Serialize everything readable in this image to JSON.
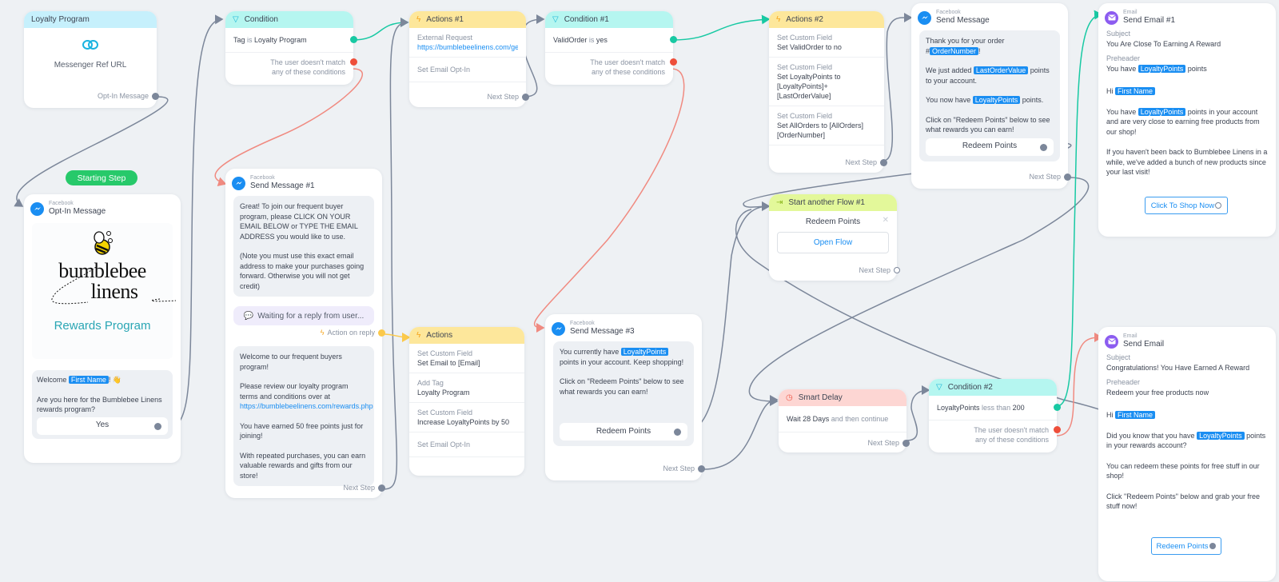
{
  "colors": {
    "canvas": "#eef1f4",
    "condition_header": "#b5f6f0",
    "actions_header": "#fde79b",
    "trigger_header": "#c6f0fc",
    "flow_header": "#e3f89a",
    "delay_header": "#fdd6d3",
    "start_badge": "#27c96a",
    "variable_tag": "#1a8ef2",
    "link": "#1a8ef2",
    "wire": "#7c879a",
    "wire_yes": "#18c9a3",
    "wire_no": "#f08a80"
  },
  "starting_step": {
    "label": "Starting Step"
  },
  "trigger": {
    "title": "Loyalty Program",
    "icon": "link-icon",
    "label": "Messenger Ref URL",
    "output": "Opt-In Message"
  },
  "optin": {
    "channel": "Facebook",
    "title": "Opt-In Message",
    "logo_line1": "bumblebee",
    "logo_line2": "linens",
    "logo_subtitle": "Rewards Program",
    "welcome_prefix": "Welcome",
    "welcome_var": "First Name",
    "welcome_suffix": "! 👋",
    "question": "Are you here for the Bumblebee Linens rewards program?",
    "button": "Yes"
  },
  "condition": {
    "title": "Condition",
    "rule_field": "Tag",
    "rule_op": "is",
    "rule_value": "Loyalty Program",
    "else": "The user doesn't match any of these conditions"
  },
  "actions1": {
    "title": "Actions #1",
    "items": [
      {
        "label": "External Request",
        "value": "https://bumblebeelinens.com/getl"
      },
      {
        "label": "Set Email Opt-In",
        "value": ""
      }
    ],
    "next": "Next Step"
  },
  "condition1": {
    "title": "Condition #1",
    "rule_field": "ValidOrder",
    "rule_op": "is",
    "rule_value": "yes",
    "else": "The user doesn't match any of these conditions"
  },
  "actions2": {
    "title": "Actions #2",
    "items": [
      {
        "label": "Set Custom Field",
        "value": "Set ValidOrder to no"
      },
      {
        "label": "Set Custom Field",
        "value": "Set LoyaltyPoints to [LoyaltyPoints]+[LastOrderValue]"
      },
      {
        "label": "Set Custom Field",
        "value": "Set AllOrders to [AllOrders][OrderNumber]"
      }
    ],
    "next": "Next Step"
  },
  "send_message": {
    "channel": "Facebook",
    "title": "Send Message",
    "l1_pre": "Thank you for your order #",
    "l1_var": "OrderNumber",
    "l1_post": "!",
    "l2_pre": "We just added ",
    "l2_var": "LastOrderValue",
    "l2_post": " points to your account.",
    "l3_pre": "You now have ",
    "l3_var": "LoyaltyPoints",
    "l3_post": " points.",
    "l4": "Click on \"Redeem Points\" below to see what rewards you can earn!",
    "button": "Redeem Points",
    "next": "Next Step"
  },
  "send_email1": {
    "channel": "Email",
    "title": "Send Email #1",
    "subject_label": "Subject",
    "subject": "You Are Close To Earning A Reward",
    "preheader_label": "Preheader",
    "pre_pre": "You have ",
    "pre_var": "LoyaltyPoints",
    "pre_post": " points",
    "hi": "Hi",
    "hi_var": "First Name",
    "p1_pre": "You have ",
    "p1_var": "LoyaltyPoints",
    "p1_post": " points in your account and are very close to earning free products from our shop!",
    "p2": "If you haven't been back to Bumblebee Linens in a while, we've added a bunch of new products since your last visit!",
    "button": "Click To Shop Now"
  },
  "send_message1": {
    "channel": "Facebook",
    "title": "Send Message #1",
    "bubble1_p1": "Great! To join our frequent buyer program, please CLICK ON YOUR EMAIL BELOW or TYPE THE EMAIL ADDRESS you would like to use.",
    "bubble1_p2": "(Note you must use this exact email address to make your purchases going forward. Otherwise you will not get credit)",
    "waiting": "Waiting for a reply from user...",
    "action_on_reply": "Action on reply",
    "bubble2_p1": "Welcome to our frequent buyers program!",
    "bubble2_p2": "Please review our loyalty program terms and conditions over at",
    "bubble2_link": "https://bumblebeelinens.com/rewards.php",
    "bubble2_p3": "You have earned 50 free points just for joining!",
    "bubble2_p4": "With repeated purchases, you can earn valuable rewards and gifts from our store!",
    "next": "Next Step"
  },
  "actions": {
    "title": "Actions",
    "items": [
      {
        "label": "Set Custom Field",
        "value": "Set Email to [Email]"
      },
      {
        "label": "Add Tag",
        "value": "Loyalty Program"
      },
      {
        "label": "Set Custom Field",
        "value": "Increase LoyaltyPoints by 50"
      },
      {
        "label": "Set Email Opt-In",
        "value": ""
      }
    ]
  },
  "send_message3": {
    "channel": "Facebook",
    "title": "Send Message #3",
    "l1_pre": "You currently have ",
    "l1_var": "LoyaltyPoints",
    "l1_post": " points in your account. Keep shopping!",
    "l2": "Click on \"Redeem Points\" below to see what rewards you can earn!",
    "button": "Redeem Points",
    "next": "Next Step"
  },
  "start_flow": {
    "title": "Start another Flow #1",
    "flow_name": "Redeem Points",
    "button": "Open Flow",
    "next": "Next Step"
  },
  "smart_delay": {
    "title": "Smart Delay",
    "text_pre": "Wait ",
    "text_bold": "28 Days",
    "text_post": " and then continue",
    "next": "Next Step"
  },
  "condition2": {
    "title": "Condition #2",
    "rule_field": "LoyaltyPoints",
    "rule_op": "less than",
    "rule_value": "200",
    "else": "The user doesn't match any of these conditions"
  },
  "send_email": {
    "channel": "Email",
    "title": "Send Email",
    "subject_label": "Subject",
    "subject": "Congratulations! You Have Earned A Reward",
    "preheader_label": "Preheader",
    "preheader": "Redeem your free products now",
    "hi": "Hi",
    "hi_var": "First Name",
    "p1_pre": "Did you know that you have ",
    "p1_var": "LoyaltyPoints",
    "p1_post": " points in your rewards account?",
    "p2": "You can redeem these points for free stuff in our shop!",
    "p3": "Click \"Redeem Points\" below and grab your free stuff now!",
    "button": "Redeem Points"
  }
}
